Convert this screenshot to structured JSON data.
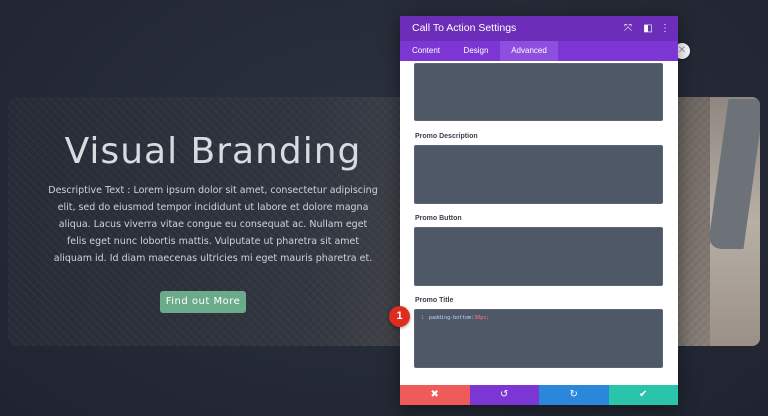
{
  "hero": {
    "title": "Visual Branding",
    "description": "Descriptive Text : Lorem ipsum dolor sit amet, consectetur adipiscing elit, sed do eiusmod tempor incididunt ut labore et dolore magna aliqua. Lacus viverra vitae congue eu consequat ac. Nullam eget felis eget nunc lobortis mattis. Vulputate ut pharetra sit amet aliquam id. Id diam maecenas ultricies mi eget mauris pharetra et.",
    "button_label": "Find out More"
  },
  "marker": {
    "number": "1"
  },
  "modal": {
    "title": "Call To Action Settings",
    "header_icons": {
      "expand": "⤧",
      "split": "◧",
      "more": "⋮"
    },
    "tabs": [
      {
        "label": "Content",
        "active": false
      },
      {
        "label": "Design",
        "active": false
      },
      {
        "label": "Advanced",
        "active": true
      }
    ],
    "fields": [
      {
        "label": "",
        "code": ""
      },
      {
        "label": "Promo Description",
        "code": ""
      },
      {
        "label": "Promo Button",
        "code": ""
      },
      {
        "label": "Promo Title",
        "code_line_number": "1",
        "code_property": "padding-bottom:",
        "code_value": "30px;"
      }
    ],
    "footer": {
      "cancel_icon": "✖",
      "undo_icon": "↺",
      "redo_icon": "↻",
      "save_icon": "✔"
    }
  },
  "colors": {
    "modal_header": "#6c2eb9",
    "tabs_bar": "#7b36d4",
    "active_tab": "#8e4fe0",
    "cancel": "#ef5a5a",
    "undo": "#7b36d4",
    "redo": "#2b87da",
    "save": "#29c4a9",
    "cta_button": "#6bab8a",
    "marker": "#e02b20"
  }
}
